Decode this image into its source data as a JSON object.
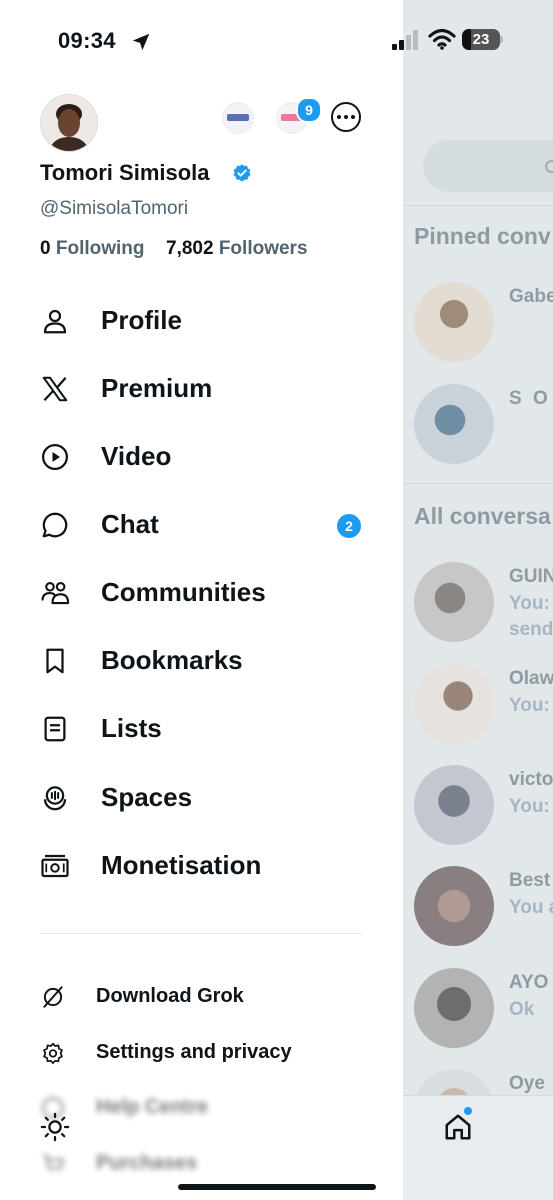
{
  "status_bar": {
    "time": "09:34",
    "battery": "23"
  },
  "profile": {
    "name": "Tomori Simisola",
    "handle": "@SimisolaTomori",
    "following_count": "0",
    "following_label": "Following",
    "followers_count": "7,802",
    "followers_label": "Followers",
    "switch_account_badge": "9"
  },
  "menu": [
    {
      "label": "Profile",
      "icon": "person-icon"
    },
    {
      "label": "Premium",
      "icon": "x-logo-icon"
    },
    {
      "label": "Video",
      "icon": "play-icon"
    },
    {
      "label": "Chat",
      "icon": "chat-bubble-icon",
      "badge": "2"
    },
    {
      "label": "Communities",
      "icon": "communities-icon"
    },
    {
      "label": "Bookmarks",
      "icon": "bookmark-icon"
    },
    {
      "label": "Lists",
      "icon": "list-icon"
    },
    {
      "label": "Spaces",
      "icon": "spaces-icon"
    },
    {
      "label": "Monetisation",
      "icon": "money-icon"
    }
  ],
  "secondary_menu": [
    {
      "label": "Download Grok",
      "icon": "grok-icon"
    },
    {
      "label": "Settings and privacy",
      "icon": "gear-icon"
    },
    {
      "label": "Help Centre",
      "icon": "help-icon"
    },
    {
      "label": "Purchases",
      "icon": "cart-icon"
    }
  ],
  "display_toggle_icon": "sun-icon",
  "background_panel": {
    "pinned_heading": "Pinned conv",
    "pinned": [
      {
        "name": "Gabe"
      },
      {
        "name": "S O J"
      }
    ],
    "all_heading": "All conversa",
    "conversations": [
      {
        "name": "GUIN",
        "preview": "You:",
        "preview2": "send"
      },
      {
        "name": "Olaw",
        "preview": "You:"
      },
      {
        "name": "victo",
        "preview": "You:"
      },
      {
        "name": "Best",
        "preview": "You a"
      },
      {
        "name": "AYO",
        "preview": "Ok"
      },
      {
        "name": "Oye"
      }
    ]
  },
  "colors": {
    "accent": "#1d9bf0",
    "text": "#0f1419",
    "secondary_text": "#536471"
  }
}
